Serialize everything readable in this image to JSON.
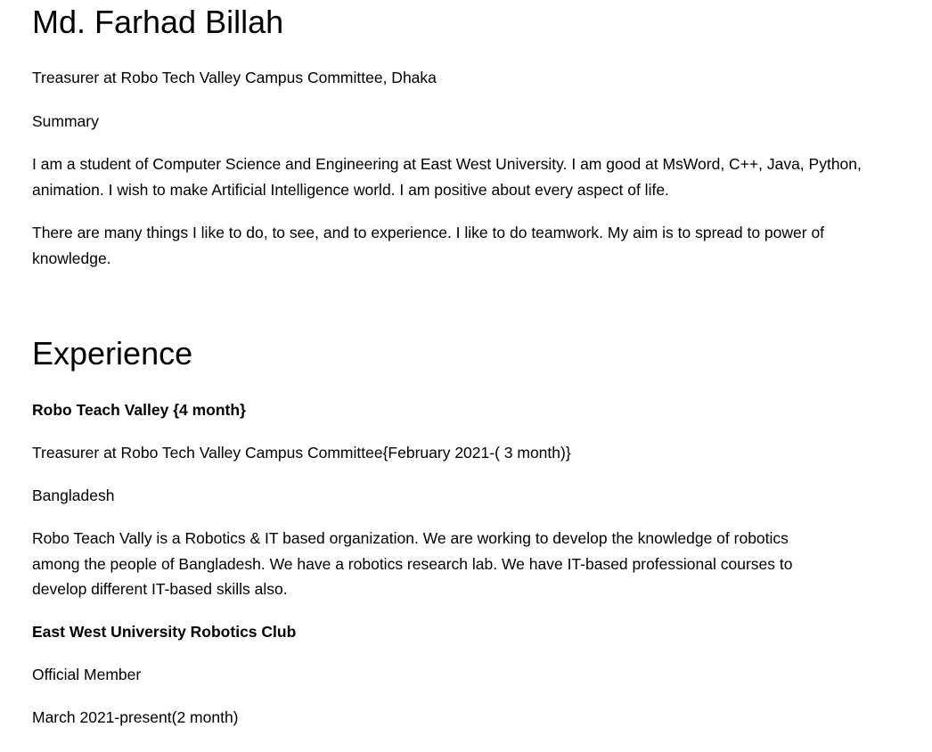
{
  "header": {
    "name": "Md. Farhad Billah",
    "headline": "Treasurer at Robo Tech Valley Campus Committee, Dhaka"
  },
  "summary": {
    "heading": "Summary",
    "paragraphs": [
      "I am a student of Computer Science and Engineering at East West University. I am good at MsWord, C++, Java, Python, animation. I wish to make Artificial Intelligence world. I am positive about every aspect of life.",
      "There are many things I like to do, to see, and to experience. I like to do teamwork. My aim is to spread to power of knowledge."
    ]
  },
  "experience": {
    "heading": "Experience",
    "items": [
      {
        "organization": "Robo Teach Valley {4 month}",
        "role": "Treasurer at Robo Tech Valley Campus Committee{February  2021-( 3 month)}",
        "location": "Bangladesh",
        "description": "Robo Teach Vally is a Robotics & IT based organization. We are working to develop the knowledge of robotics among the people of Bangladesh. We have a robotics research lab. We have IT-based professional courses to develop different IT-based skills also."
      },
      {
        "organization": "East West University Robotics Club",
        "role": "Official Member",
        "dates": "March 2021-present(2 month)"
      }
    ]
  }
}
